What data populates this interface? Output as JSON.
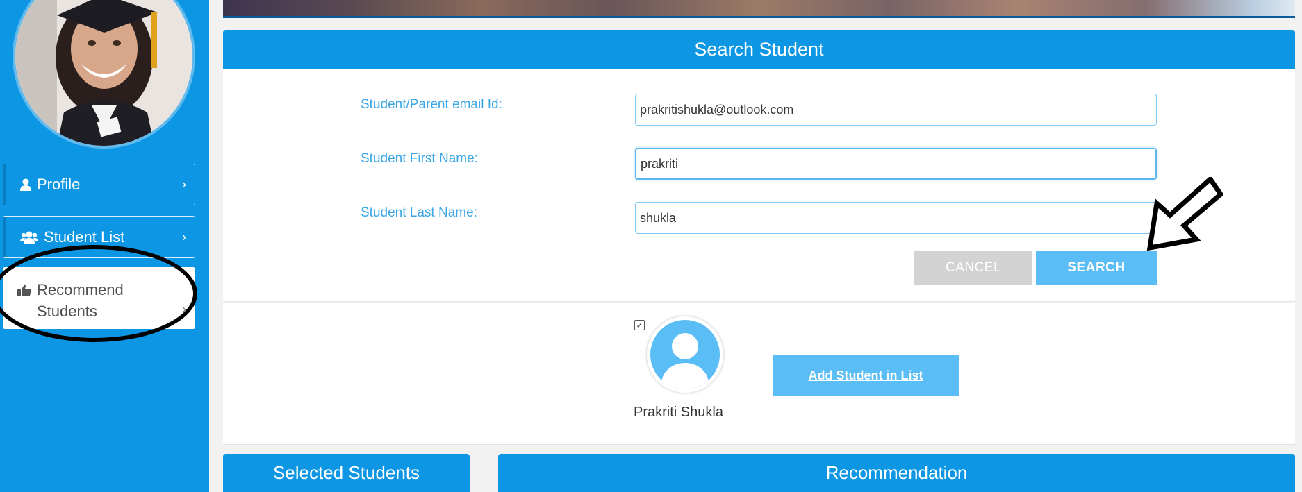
{
  "sidebar": {
    "items": [
      {
        "label": "Profile",
        "icon": "user-icon"
      },
      {
        "label": "Student List",
        "icon": "users-icon"
      },
      {
        "label": "Recommend Students",
        "icon": "thumbs-up-icon"
      }
    ]
  },
  "search_panel": {
    "title": "Search Student",
    "fields": [
      {
        "label": "Student/Parent email Id:",
        "value": "prakritishukla@outlook.com"
      },
      {
        "label": "Student First Name:",
        "value": "prakriti"
      },
      {
        "label": "Student Last Name:",
        "value": "shukla"
      }
    ],
    "cancel_label": "CANCEL",
    "search_label": "SEARCH"
  },
  "results": {
    "student_name": "Prakriti Shukla",
    "add_label": "Add Student in List",
    "checked": true
  },
  "bottom": {
    "selected_title": "Selected Students",
    "recommendation_title": "Recommendation"
  },
  "colors": {
    "primary": "#0c96e4",
    "light_button": "#5bbdf5",
    "label": "#3aa6e6",
    "cancel": "#d3d3d3"
  }
}
